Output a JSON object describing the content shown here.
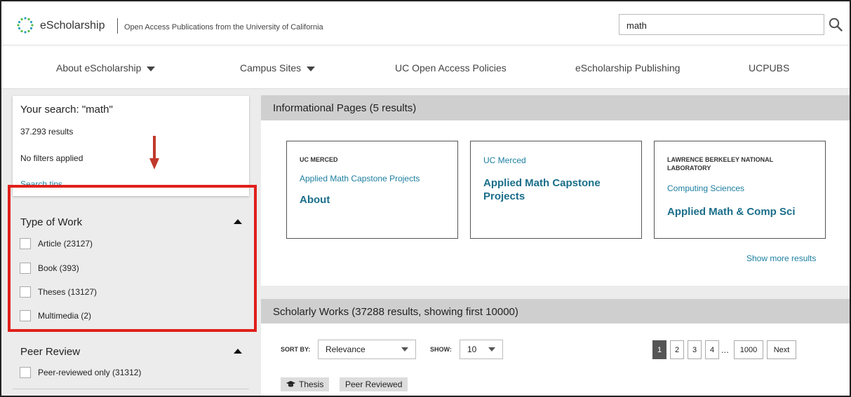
{
  "header": {
    "brand": "eScholarship",
    "tagline": "Open Access Publications from the University of California",
    "search_value": "math",
    "search_icon": "search-icon"
  },
  "nav": {
    "items": [
      {
        "label": "About eScholarship",
        "has_menu": true
      },
      {
        "label": "Campus Sites",
        "has_menu": true
      },
      {
        "label": "UC Open Access Policies",
        "has_menu": false
      },
      {
        "label": "eScholarship Publishing",
        "has_menu": false
      },
      {
        "label": "UCPUBS",
        "has_menu": false
      }
    ]
  },
  "search_summary": {
    "title": "Your search: \"math\"",
    "results": "37.293 results",
    "filters": "No filters applied",
    "tips": "Search tips"
  },
  "facets": {
    "type_of_work": {
      "title": "Type of Work",
      "options": [
        "Article (23127)",
        "Book (393)",
        "Theses (13127)",
        "Multimedia (2)"
      ]
    },
    "peer_review": {
      "title": "Peer Review",
      "options": [
        "Peer-reviewed only (31312)"
      ]
    }
  },
  "informational": {
    "header": "Informational Pages (5 results)",
    "cards": [
      {
        "campus": "UC MERCED",
        "campus_style": "caps",
        "unit": "Applied Math Capstone Projects",
        "title": "About"
      },
      {
        "campus": "UC Merced",
        "campus_style": "normal",
        "unit": "",
        "title": "Applied Math Capstone Projects"
      },
      {
        "campus": "LAWRENCE BERKELEY NATIONAL LABORATORY",
        "campus_style": "caps",
        "unit": "Computing Sciences",
        "title": "Applied Math & Comp Sci"
      }
    ],
    "show_more": "Show more results"
  },
  "works": {
    "header": "Scholarly Works (37288 results, showing first 10000)",
    "sort_label": "SORT BY:",
    "sort_value": "Relevance",
    "show_label": "SHOW:",
    "show_value": "10",
    "pages": [
      "1",
      "2",
      "3",
      "4"
    ],
    "ellipsis": "...",
    "last_page": "1000",
    "next": "Next",
    "current_page": "1",
    "tags": [
      "Thesis",
      "Peer Reviewed"
    ]
  },
  "colors": {
    "highlight": "#e0201b",
    "arrow": "#c0392b",
    "link": "#1c7ea0",
    "bar": "#cfcfcf"
  }
}
